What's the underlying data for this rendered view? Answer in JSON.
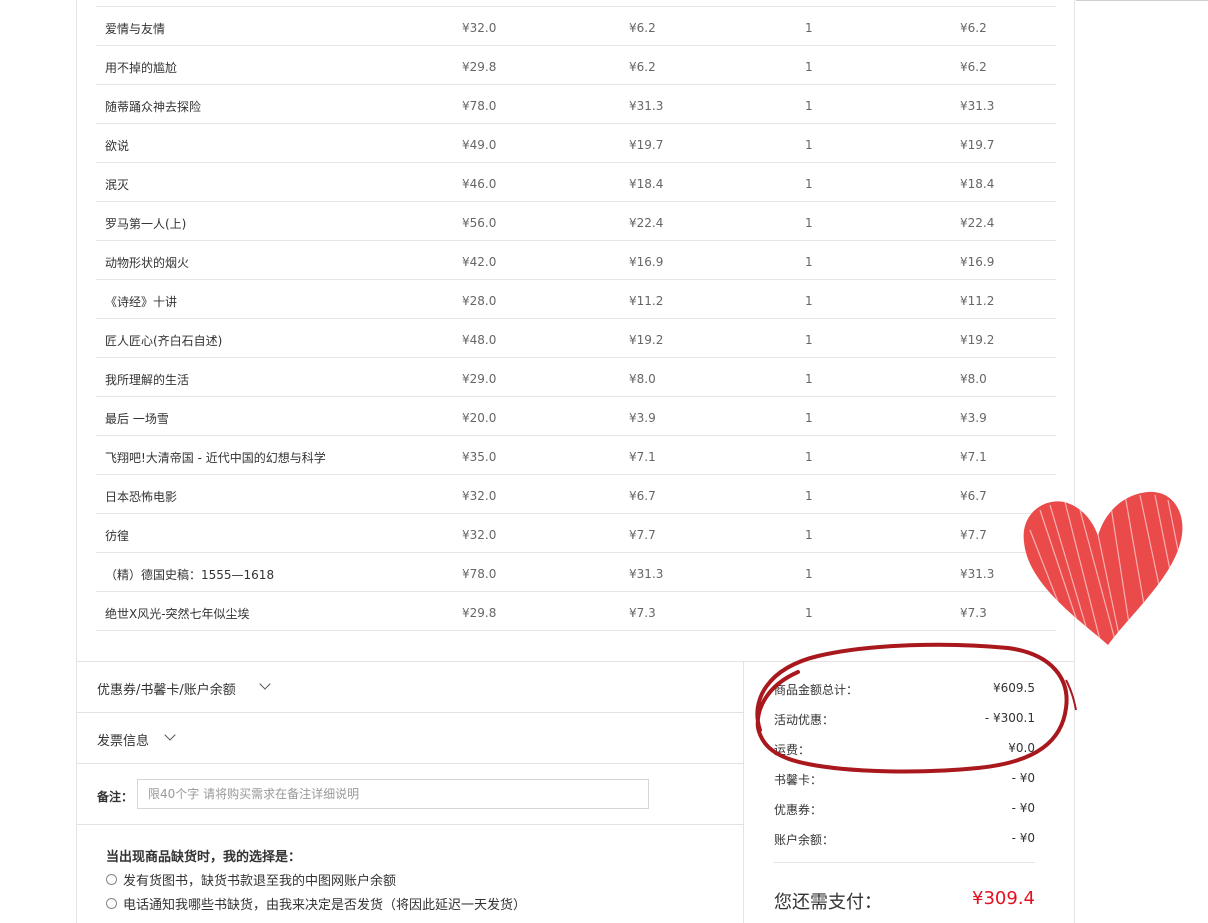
{
  "items": [
    {
      "title": "爱情与友情",
      "price": "¥32.0",
      "discount": "¥6.2",
      "qty": "1",
      "subtotal": "¥6.2"
    },
    {
      "title": "用不掉的尴尬",
      "price": "¥29.8",
      "discount": "¥6.2",
      "qty": "1",
      "subtotal": "¥6.2"
    },
    {
      "title": "随蒂踊众神去探险",
      "price": "¥78.0",
      "discount": "¥31.3",
      "qty": "1",
      "subtotal": "¥31.3"
    },
    {
      "title": "欲说",
      "price": "¥49.0",
      "discount": "¥19.7",
      "qty": "1",
      "subtotal": "¥19.7"
    },
    {
      "title": "泯灭",
      "price": "¥46.0",
      "discount": "¥18.4",
      "qty": "1",
      "subtotal": "¥18.4"
    },
    {
      "title": "罗马第一人(上)",
      "price": "¥56.0",
      "discount": "¥22.4",
      "qty": "1",
      "subtotal": "¥22.4"
    },
    {
      "title": "动物形状的烟火",
      "price": "¥42.0",
      "discount": "¥16.9",
      "qty": "1",
      "subtotal": "¥16.9"
    },
    {
      "title": "《诗经》十讲",
      "price": "¥28.0",
      "discount": "¥11.2",
      "qty": "1",
      "subtotal": "¥11.2"
    },
    {
      "title": "匠人匠心(齐白石自述)",
      "price": "¥48.0",
      "discount": "¥19.2",
      "qty": "1",
      "subtotal": "¥19.2"
    },
    {
      "title": "我所理解的生活",
      "price": "¥29.0",
      "discount": "¥8.0",
      "qty": "1",
      "subtotal": "¥8.0"
    },
    {
      "title": "最后 一场雪",
      "price": "¥20.0",
      "discount": "¥3.9",
      "qty": "1",
      "subtotal": "¥3.9"
    },
    {
      "title": "飞翔吧!大清帝国 - 近代中国的幻想与科学",
      "price": "¥35.0",
      "discount": "¥7.1",
      "qty": "1",
      "subtotal": "¥7.1"
    },
    {
      "title": "日本恐怖电影",
      "price": "¥32.0",
      "discount": "¥6.7",
      "qty": "1",
      "subtotal": "¥6.7"
    },
    {
      "title": "彷徨",
      "price": "¥32.0",
      "discount": "¥7.7",
      "qty": "1",
      "subtotal": "¥7.7"
    },
    {
      "title": "（精）德国史稿：1555—1618",
      "price": "¥78.0",
      "discount": "¥31.3",
      "qty": "1",
      "subtotal": "¥31.3"
    },
    {
      "title": "绝世X风光-突然七年似尘埃",
      "price": "¥29.8",
      "discount": "¥7.3",
      "qty": "1",
      "subtotal": "¥7.3"
    }
  ],
  "coupon_section": {
    "label": "优惠券/书馨卡/账户余额"
  },
  "invoice_section": {
    "label": "发票信息"
  },
  "remark": {
    "label": "备注：",
    "placeholder": "限40个字 请将购买需求在备注详细说明"
  },
  "out_of_stock": {
    "title": "当出现商品缺货时，我的选择是：",
    "options": [
      "发有货图书，缺货书款退至我的中图网账户余额",
      "电话通知我哪些书缺货，由我来决定是否发货（将因此延迟一天发货）"
    ]
  },
  "summary": {
    "goods_total_label": "商品金额总计：",
    "goods_total": "¥609.5",
    "promo_label": "活动优惠：",
    "promo": "- ¥300.1",
    "shipping_label": "运费：",
    "shipping": "¥0.0",
    "card_label": "书馨卡：",
    "card": "- ¥0",
    "coupon_label": "优惠券：",
    "coupon": "- ¥0",
    "balance_label": "账户余额：",
    "balance": "- ¥0",
    "pay_label": "您还需支付：",
    "pay": "¥309.4"
  },
  "colors": {
    "accent": "#e4101e",
    "annotation": "#a8181d",
    "heart": "#ea4a4a"
  }
}
